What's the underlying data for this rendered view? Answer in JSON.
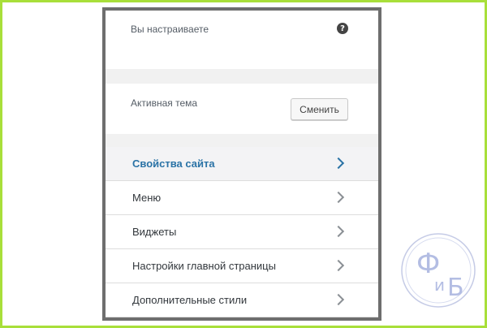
{
  "header": {
    "you_customize": "Вы настраиваете",
    "help_icon": "question-icon"
  },
  "theme": {
    "label": "Активная тема",
    "change_button": "Сменить"
  },
  "menu": [
    {
      "label": "Свойства сайта",
      "active": true
    },
    {
      "label": "Меню",
      "active": false
    },
    {
      "label": "Виджеты",
      "active": false
    },
    {
      "label": "Настройки главной страницы",
      "active": false
    },
    {
      "label": "Дополнительные стили",
      "active": false
    }
  ],
  "logo": {
    "text": "ФиБ"
  },
  "colors": {
    "frame_border": "#a8df3a",
    "panel_border": "#6e6e6e",
    "accent": "#2b73a6"
  }
}
